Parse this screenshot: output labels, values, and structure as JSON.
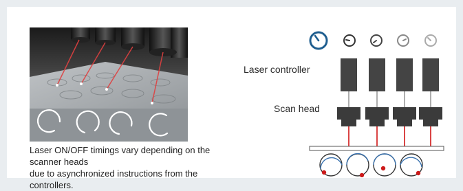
{
  "diagram": {
    "controller_label": "Laser controller",
    "scan_head_label": "Scan head",
    "caption_line1": "Laser ON/OFF timings vary depending on the scanner heads",
    "caption_line2": "due to asynchronized instructions from the controllers."
  },
  "colors": {
    "background": "#e9edf0",
    "controller_block": "#444444",
    "scan_head_block": "#3b3b3b",
    "laser_line": "#d11515",
    "clock_accent": "#1f5e8f",
    "timing_arc": "#3a73b0",
    "timing_dot": "#cc1a1a"
  },
  "icons": [
    "clock-icon",
    "timing-circle-icon"
  ]
}
